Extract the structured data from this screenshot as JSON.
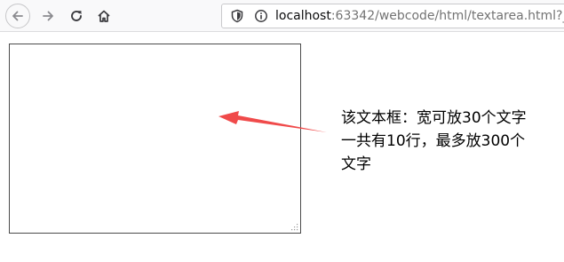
{
  "browser": {
    "url_host": "localhost",
    "url_rest": ":63342/webcode/html/textarea.html?_ijt",
    "icons": {
      "back": "arrow-left-icon",
      "forward": "arrow-right-icon",
      "reload": "reload-icon",
      "home": "home-icon",
      "shield": "shield-icon",
      "info": "info-icon"
    }
  },
  "page": {
    "textarea_value": "",
    "annotation": {
      "line1": "该文本框：宽可放30个文字",
      "line2": "一共有10行，最多放300个",
      "line3": "文字"
    },
    "arrow_color": "#f04a4a"
  }
}
